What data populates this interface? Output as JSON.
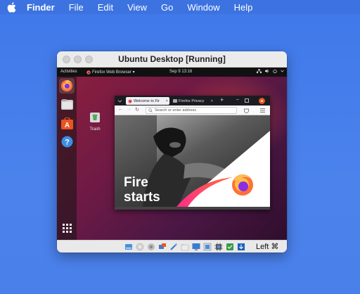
{
  "mac_menubar": {
    "apple_icon": "apple-icon",
    "items": [
      "Finder",
      "File",
      "Edit",
      "View",
      "Go",
      "Window",
      "Help"
    ]
  },
  "vbox_window": {
    "title": "Ubuntu Desktop [Running]",
    "host_key": "Left ⌘"
  },
  "ubuntu": {
    "activities": "Activities",
    "app_menu": "Firefox Web Browser ▾",
    "clock": "Sep 9  13:16",
    "desktop_icons": [
      {
        "label": "Trash"
      }
    ],
    "dock": [
      "firefox-icon",
      "files-icon",
      "software-icon",
      "help-icon",
      "show-apps-icon"
    ]
  },
  "firefox": {
    "tabs": [
      {
        "label": "Welcome to Fir",
        "active": true
      },
      {
        "label": "Firefox Privacy",
        "active": false
      }
    ],
    "url_placeholder": "Search or enter address",
    "hero_text_line1": "Fire",
    "hero_text_line2": "starts"
  },
  "colors": {
    "mac_background": "#4a7fe6",
    "ubuntu_wallpaper": "#7a1c44",
    "firefox_orange": "#ff7139",
    "firefox_pink": "#ff2a8a"
  }
}
